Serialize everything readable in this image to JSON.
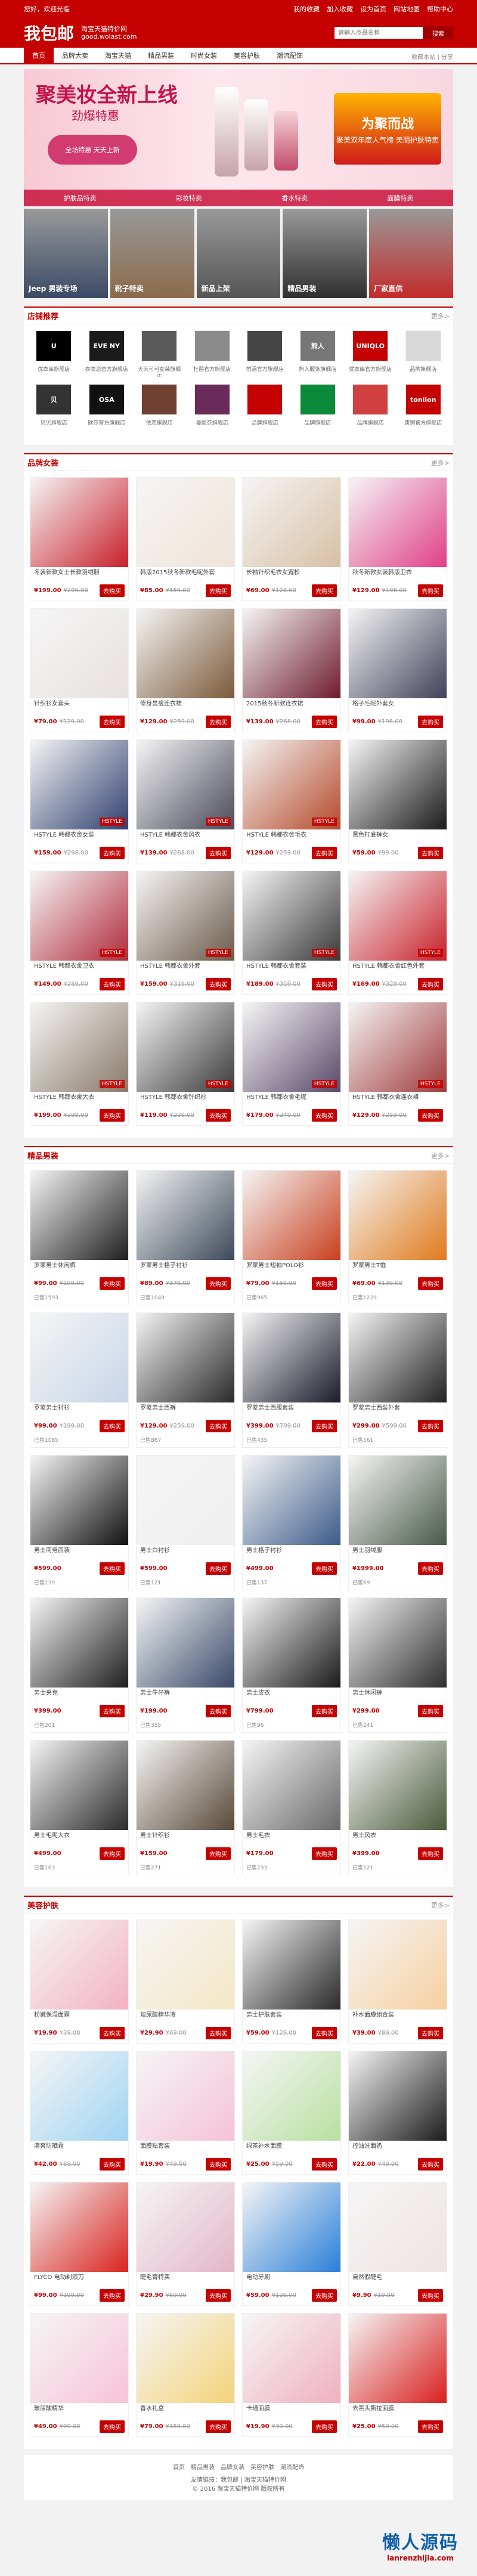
{
  "topbar": {
    "left": "您好，欢迎光临",
    "right_items": [
      "我的收藏",
      "加入收藏",
      "设为首页",
      "网站地图",
      "帮助中心"
    ]
  },
  "header": {
    "logo": "我包邮",
    "slogan_line1": "淘宝天猫特价网",
    "slogan_line2": "good.wolast.com",
    "search_placeholder": "请输入商品名称",
    "search_button": "搜索"
  },
  "nav": {
    "items": [
      "首页",
      "品牌大卖",
      "淘宝天猫",
      "精品男装",
      "时尚女装",
      "美容护肤",
      "潮流配饰"
    ],
    "tools": "收藏本站 | 分享"
  },
  "banner": {
    "title": "聚美妆全新上线",
    "subtitle": "劲爆特惠",
    "badge": "全场特惠 天天上新",
    "right_title": "为聚而战",
    "right_text": "聚美双年度人气榜 美丽护肤特卖",
    "strip": [
      "护肤品特卖",
      "彩妆特卖",
      "香水特卖",
      "面膜特卖"
    ]
  },
  "promos": [
    {
      "label": "Jeep 男装专场",
      "color": "#3b4a66"
    },
    {
      "label": "靴子特卖",
      "color": "#8a6a4b"
    },
    {
      "label": "新品上架",
      "color": "#555"
    },
    {
      "label": "精品男装",
      "color": "#2f2f2f"
    },
    {
      "label": "厂家直供",
      "color": "#c42b2b"
    }
  ],
  "sections": {
    "brands": "店铺推荐",
    "women": "品牌女装",
    "men": "精品男装",
    "beauty": "美容护肤",
    "more": "更多>"
  },
  "brands": [
    {
      "name": "U",
      "title": "优衣库旗舰店",
      "color": "#000"
    },
    {
      "name": "EVE NY",
      "title": "衣衣恋官方旗舰店",
      "color": "#1b1b1b"
    },
    {
      "name": "",
      "title": "天天可可女装旗舰店",
      "color": "#5a5a5a"
    },
    {
      "name": "",
      "title": "杜鹃官方旗舰店",
      "color": "#8a8a8a"
    },
    {
      "name": "",
      "title": "悦涵官方旗舰店",
      "color": "#444"
    },
    {
      "name": "熊人",
      "title": "熊人服饰旗舰店",
      "color": "#777"
    },
    {
      "name": "UNIQLO",
      "title": "优衣库官方旗舰店",
      "color": "#c40000"
    },
    {
      "name": "",
      "title": "品牌旗舰店",
      "color": "#d9d9d9"
    },
    {
      "name": "贝",
      "title": "贝贝旗舰店",
      "color": "#333"
    },
    {
      "name": "OSA",
      "title": "欧莎官方旗舰店",
      "color": "#111"
    },
    {
      "name": "",
      "title": "依恋旗舰店",
      "color": "#704030"
    },
    {
      "name": "",
      "title": "曼妮芬旗舰店",
      "color": "#6a2a5a"
    },
    {
      "name": "",
      "title": "品牌旗舰店",
      "color": "#c40000"
    },
    {
      "name": "",
      "title": "品牌旗舰店",
      "color": "#0b8a3a"
    },
    {
      "name": "",
      "title": "品牌旗舰店",
      "color": "#d04040"
    },
    {
      "name": "tonlion",
      "title": "唐狮官方旗舰店",
      "color": "#c40000"
    }
  ],
  "women_items": [
    {
      "title": "冬装新款女士长款羽绒服",
      "price": "¥199.00",
      "old": "¥299.00",
      "btn": "去购买",
      "color": "#c8212c",
      "tag": ""
    },
    {
      "title": "韩版2015秋冬新款毛呢外套",
      "price": "¥85.00",
      "old": "¥159.00",
      "btn": "去购买",
      "color": "#efe4d8",
      "tag": ""
    },
    {
      "title": "长袖针织毛衣女宽松",
      "price": "¥69.00",
      "old": "¥128.00",
      "btn": "去购买",
      "color": "#d7c0a4",
      "tag": ""
    },
    {
      "title": "秋冬新款女装韩版卫衣",
      "price": "¥129.00",
      "old": "¥198.00",
      "btn": "去购买",
      "color": "#e03f86",
      "tag": ""
    },
    {
      "title": "针织衫女套头",
      "price": "¥79.00",
      "old": "¥129.00",
      "btn": "去购买",
      "color": "#e8e1e1",
      "tag": ""
    },
    {
      "title": "修身显瘦连衣裙",
      "price": "¥129.00",
      "old": "¥259.00",
      "btn": "去购买",
      "color": "#7b5a3a",
      "tag": ""
    },
    {
      "title": "2015秋冬新款连衣裙",
      "price": "¥139.00",
      "old": "¥268.00",
      "btn": "去购买",
      "color": "#6e1b2e",
      "tag": ""
    },
    {
      "title": "格子毛呢外套女",
      "price": "¥99.00",
      "old": "¥198.00",
      "btn": "去购买",
      "color": "#41415a",
      "tag": ""
    },
    {
      "title": "HSTYLE 韩都衣舍女装",
      "price": "¥159.00",
      "old": "¥298.00",
      "btn": "去购买",
      "color": "#2f3f6f",
      "tag": "HSTYLE"
    },
    {
      "title": "HSTYLE 韩都衣舍风衣",
      "price": "¥139.00",
      "old": "¥268.00",
      "btn": "去购买",
      "color": "#4a4a5a",
      "tag": "HSTYLE"
    },
    {
      "title": "HSTYLE 韩都衣舍毛衣",
      "price": "¥129.00",
      "old": "¥259.00",
      "btn": "去购买",
      "color": "#b44a2a",
      "tag": "HSTYLE"
    },
    {
      "title": "黑色打底裤女",
      "price": "¥59.00",
      "old": "¥99.00",
      "btn": "去购买",
      "color": "#1b1b1b",
      "tag": ""
    },
    {
      "title": "HSTYLE 韩都衣舍卫衣",
      "price": "¥149.00",
      "old": "¥289.00",
      "btn": "去购买",
      "color": "#b02c3c",
      "tag": "HSTYLE"
    },
    {
      "title": "HSTYLE 韩都衣舍外套",
      "price": "¥159.00",
      "old": "¥319.00",
      "btn": "去购买",
      "color": "#6b5a4a",
      "tag": "HSTYLE"
    },
    {
      "title": "HSTYLE 韩都衣舍套装",
      "price": "¥189.00",
      "old": "¥359.00",
      "btn": "去购买",
      "color": "#3a3a3a",
      "tag": "HSTYLE"
    },
    {
      "title": "HSTYLE 韩都衣舍红色外套",
      "price": "¥169.00",
      "old": "¥329.00",
      "btn": "去购买",
      "color": "#c8202a",
      "tag": "HSTYLE"
    },
    {
      "title": "HSTYLE 韩都衣舍大衣",
      "price": "¥199.00",
      "old": "¥399.00",
      "btn": "去购买",
      "color": "#8a7a6a",
      "tag": "HSTYLE"
    },
    {
      "title": "HSTYLE 韩都衣舍针织衫",
      "price": "¥119.00",
      "old": "¥239.00",
      "btn": "去购买",
      "color": "#3b3b3b",
      "tag": "HSTYLE"
    },
    {
      "title": "HSTYLE 韩都衣舍毛呢",
      "price": "¥179.00",
      "old": "¥349.00",
      "btn": "去购买",
      "color": "#5a4a6a",
      "tag": "HSTYLE"
    },
    {
      "title": "HSTYLE 韩都衣舍连衣裙",
      "price": "¥129.00",
      "old": "¥259.00",
      "btn": "去购买",
      "color": "#a03a3a",
      "tag": "HSTYLE"
    }
  ],
  "men_items": [
    {
      "title": "罗蒙男士休闲裤",
      "price": "¥99.00",
      "old": "¥199.00",
      "sold": "已售1593",
      "btn": "去购买",
      "color": "#1f1f1f"
    },
    {
      "title": "罗蒙男士格子衬衫",
      "price": "¥89.00",
      "old": "¥179.00",
      "sold": "已售1049",
      "btn": "去购买",
      "color": "#3d4a5a"
    },
    {
      "title": "罗蒙男士短袖POLO衫",
      "price": "¥79.00",
      "old": "¥159.00",
      "sold": "已售965",
      "btn": "去购买",
      "color": "#c8401f"
    },
    {
      "title": "罗蒙男士T恤",
      "price": "¥69.00",
      "old": "¥139.00",
      "sold": "已售1229",
      "btn": "去购买",
      "color": "#e07a1c"
    },
    {
      "title": "罗蒙男士衬衫",
      "price": "¥99.00",
      "old": "¥199.00",
      "sold": "已售1085",
      "btn": "去购买",
      "color": "#c8d5e8"
    },
    {
      "title": "罗蒙男士西裤",
      "price": "¥129.00",
      "old": "¥259.00",
      "sold": "已售867",
      "btn": "去购买",
      "color": "#2a2a2a"
    },
    {
      "title": "罗蒙男士西服套装",
      "price": "¥399.00",
      "old": "¥799.00",
      "sold": "已售435",
      "btn": "去购买",
      "color": "#1b1b2b"
    },
    {
      "title": "罗蒙男士西装外套",
      "price": "¥299.00",
      "old": "¥599.00",
      "sold": "已售561",
      "btn": "去购买",
      "color": "#222"
    },
    {
      "title": "男士商务西装",
      "price": "¥599.00",
      "old": "",
      "sold": "已售139",
      "btn": "去购买",
      "color": "#111"
    },
    {
      "title": "男士白衬衫",
      "price": "¥599.00",
      "old": "",
      "sold": "已售121",
      "btn": "去购买",
      "color": "#efefef"
    },
    {
      "title": "男士格子衬衫",
      "price": "¥499.00",
      "old": "",
      "sold": "已售137",
      "btn": "去购买",
      "color": "#3d5c8a"
    },
    {
      "title": "男士羽绒服",
      "price": "¥1999.00",
      "old": "",
      "sold": "已售69",
      "btn": "去购买",
      "color": "#4a5a4a"
    },
    {
      "title": "男士夹克",
      "price": "¥399.00",
      "old": "",
      "sold": "已售201",
      "btn": "去购买",
      "color": "#1f1f1f"
    },
    {
      "title": "男士牛仔裤",
      "price": "¥199.00",
      "old": "",
      "sold": "已售355",
      "btn": "去购买",
      "color": "#3a4a6a"
    },
    {
      "title": "男士皮衣",
      "price": "¥799.00",
      "old": "",
      "sold": "已售96",
      "btn": "去购买",
      "color": "#1a1a1a"
    },
    {
      "title": "男士休闲裤",
      "price": "¥299.00",
      "old": "",
      "sold": "已售241",
      "btn": "去购买",
      "color": "#2e2e2e"
    },
    {
      "title": "男士毛呢大衣",
      "price": "¥499.00",
      "old": "",
      "sold": "已售163",
      "btn": "去购买",
      "color": "#2b2b2b"
    },
    {
      "title": "男士针织衫",
      "price": "¥159.00",
      "old": "",
      "sold": "已售271",
      "btn": "去购买",
      "color": "#5a4a3a"
    },
    {
      "title": "男士毛衣",
      "price": "¥179.00",
      "old": "",
      "sold": "已售233",
      "btn": "去购买",
      "color": "#6a6a6a"
    },
    {
      "title": "男士风衣",
      "price": "¥399.00",
      "old": "",
      "sold": "已售121",
      "btn": "去购买",
      "color": "#4b5b3b"
    }
  ],
  "beauty_items": [
    {
      "title": "粉嫩保湿面霜",
      "price": "¥19.90",
      "old": "¥39.00",
      "btn": "去购买",
      "color": "#f3b2c2"
    },
    {
      "title": "玻尿酸精华液",
      "price": "¥29.90",
      "old": "¥69.00",
      "btn": "去购买",
      "color": "#f4e7c4"
    },
    {
      "title": "男士护肤套装",
      "price": "¥59.00",
      "old": "¥129.00",
      "btn": "去购买",
      "color": "#2a2a2a"
    },
    {
      "title": "补水面膜组合装",
      "price": "¥39.00",
      "old": "¥89.00",
      "btn": "去购买",
      "color": "#f6d0a0"
    },
    {
      "title": "清爽防晒霜",
      "price": "¥42.00",
      "old": "¥89.00",
      "btn": "去购买",
      "color": "#9fd4f2"
    },
    {
      "title": "面膜贴套装",
      "price": "¥19.90",
      "old": "¥49.00",
      "btn": "去购买",
      "color": "#f5c2d8"
    },
    {
      "title": "绿茶补水面膜",
      "price": "¥25.00",
      "old": "¥59.00",
      "btn": "去购买",
      "color": "#b8e0a0"
    },
    {
      "title": "控油洗面奶",
      "price": "¥22.00",
      "old": "¥49.00",
      "btn": "去购买",
      "color": "#1b1b1b"
    },
    {
      "title": "FLYCO 电动剃须刀",
      "price": "¥99.00",
      "old": "¥199.00",
      "btn": "去购买",
      "color": "#d8241f"
    },
    {
      "title": "睫毛膏特卖",
      "price": "¥29.90",
      "old": "¥69.00",
      "btn": "去购买",
      "color": "#e3b6c7"
    },
    {
      "title": "电动牙刷",
      "price": "¥59.00",
      "old": "¥129.00",
      "btn": "去购买",
      "color": "#2a7fd8"
    },
    {
      "title": "自然假睫毛",
      "price": "¥9.90",
      "old": "¥19.90",
      "btn": "去购买",
      "color": "#efe4e4"
    },
    {
      "title": "玻尿酸精华",
      "price": "¥49.00",
      "old": "¥99.00",
      "btn": "去购买",
      "color": "#f7c3d6"
    },
    {
      "title": "香水礼盒",
      "price": "¥79.00",
      "old": "¥159.00",
      "btn": "去购买",
      "color": "#f3d37a"
    },
    {
      "title": "卡通面膜",
      "price": "¥19.90",
      "old": "¥39.00",
      "btn": "去购买",
      "color": "#f0b0c0"
    },
    {
      "title": "去黑头撕拉面膜",
      "price": "¥25.00",
      "old": "¥59.00",
      "btn": "去购买",
      "color": "#d8201f"
    }
  ],
  "footer": {
    "links": [
      "首页",
      "精品男装",
      "品牌女装",
      "美容护肤",
      "潮流配饰"
    ],
    "line1": "友情链接：我包邮 | 淘宝天猫特价网",
    "line2": "© 2016 淘宝天猫特价网 版权所有"
  },
  "watermark": {
    "big": "懒人源码",
    "small": "lanrenzhijia.com"
  }
}
